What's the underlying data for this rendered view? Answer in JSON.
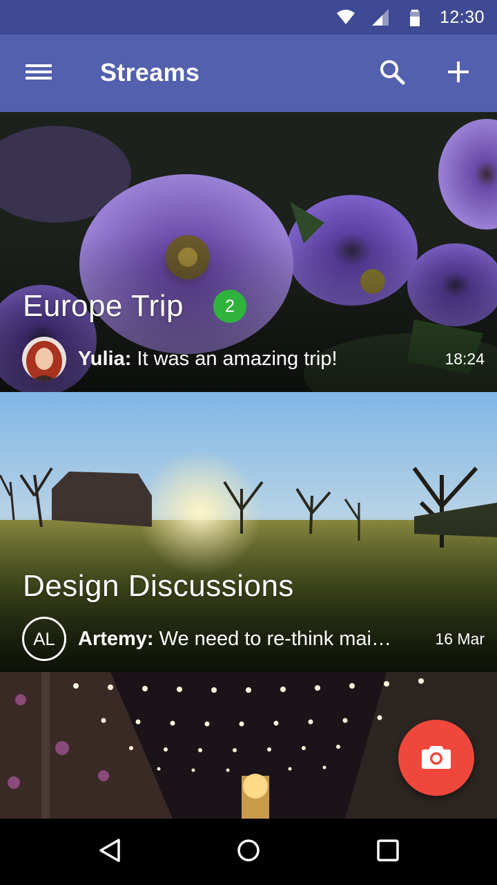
{
  "status_bar": {
    "time": "12:30",
    "icons": [
      "wifi-icon",
      "cellular-signal-icon",
      "battery-icon"
    ]
  },
  "app_bar": {
    "title": "Streams",
    "icons": [
      "menu-icon",
      "search-icon",
      "add-icon"
    ]
  },
  "streams": [
    {
      "title": "Europe Trip",
      "badge": "2",
      "sender": "Yulia:",
      "message": " It was an amazing trip!",
      "time": "18:24",
      "avatar": "photo"
    },
    {
      "title": "Design Discussions",
      "sender": "Artemy:",
      "message": " We need to re-think mai…",
      "time": "16 Mar",
      "avatar_initials": "AL"
    }
  ],
  "fab": {
    "icon": "camera-icon"
  },
  "nav_bar": {
    "icons": [
      "back-icon",
      "home-icon",
      "recents-icon"
    ]
  },
  "colors": {
    "status_bar": "#3f4a94",
    "app_bar": "#5360ad",
    "badge": "#2fb33d",
    "fab": "#f0473c"
  }
}
